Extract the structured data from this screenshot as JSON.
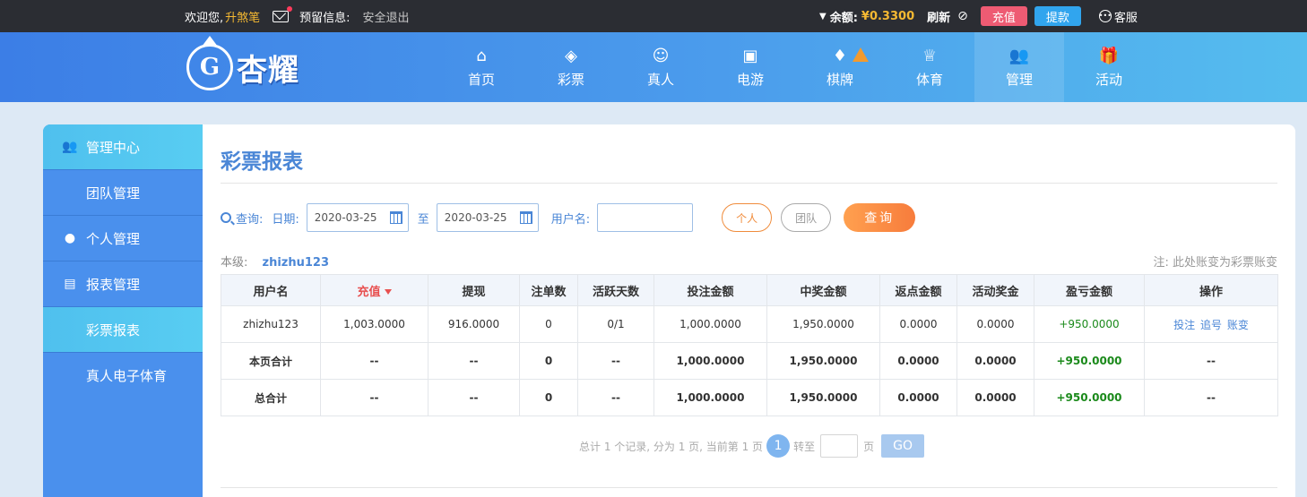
{
  "topbar": {
    "welcome": "欢迎您,",
    "username": "升煞笔",
    "reserved_info": "预留信息:",
    "logout": "安全退出",
    "balance_label": "余额:",
    "balance_value": "¥0.3300",
    "refresh": "刷新",
    "recharge": "充值",
    "withdraw": "提款",
    "service": "客服"
  },
  "logo": {
    "text": "杏耀",
    "emblem": "G"
  },
  "nav": [
    {
      "label": "首页",
      "icon": "home-icon",
      "glyph": "⌂"
    },
    {
      "label": "彩票",
      "icon": "ticket-icon",
      "glyph": "◈"
    },
    {
      "label": "真人",
      "icon": "live-dealer-icon",
      "glyph": "☺"
    },
    {
      "label": "电游",
      "icon": "slot-machine-icon",
      "glyph": "▣"
    },
    {
      "label": "棋牌",
      "icon": "cards-icon",
      "glyph": "♦"
    },
    {
      "label": "体育",
      "icon": "trophy-icon",
      "glyph": "♕"
    },
    {
      "label": "管理",
      "icon": "users-icon",
      "glyph": "👥"
    },
    {
      "label": "活动",
      "icon": "gift-icon",
      "glyph": "🎁"
    }
  ],
  "sidebar": {
    "items": [
      {
        "label": "管理中心",
        "type": "head"
      },
      {
        "label": "团队管理",
        "type": "sub"
      },
      {
        "label": "个人管理",
        "type": "head"
      },
      {
        "label": "报表管理",
        "type": "head"
      },
      {
        "label": "彩票报表",
        "type": "sub"
      },
      {
        "label": "真人电子体育",
        "type": "sub"
      }
    ]
  },
  "page": {
    "title": "彩票报表"
  },
  "query": {
    "label": "查询:",
    "date_label": "日期:",
    "date_from": "2020-03-25",
    "to": "至",
    "date_to": "2020-03-25",
    "username_label": "用户名:",
    "username_value": "",
    "personal": "个人",
    "team": "团队",
    "search": "查询"
  },
  "level": {
    "label": "本级:",
    "user": "zhizhu123"
  },
  "note": "注: 此处账变为彩票账变",
  "table": {
    "headers": [
      "用户名",
      "充值",
      "提现",
      "注单数",
      "活跃天数",
      "投注金额",
      "中奖金额",
      "返点金额",
      "活动奖金",
      "盈亏金额",
      "操作"
    ],
    "rows": [
      [
        "zhizhu123",
        "1,003.0000",
        "916.0000",
        "0",
        "0/1",
        "1,000.0000",
        "1,950.0000",
        "0.0000",
        "0.0000",
        "+950.0000"
      ],
      [
        "本页合计",
        "--",
        "--",
        "0",
        "--",
        "1,000.0000",
        "1,950.0000",
        "0.0000",
        "0.0000",
        "+950.0000",
        "--"
      ],
      [
        "总合计",
        "--",
        "--",
        "0",
        "--",
        "1,000.0000",
        "1,950.0000",
        "0.0000",
        "0.0000",
        "+950.0000",
        "--"
      ]
    ],
    "ops": [
      "投注",
      "追号",
      "账变"
    ]
  },
  "pager": {
    "summary": "总计 1 个记录, 分为 1 页, 当前第 1 页",
    "current": "1",
    "jump": "转至",
    "unit": "页",
    "go": "GO"
  }
}
